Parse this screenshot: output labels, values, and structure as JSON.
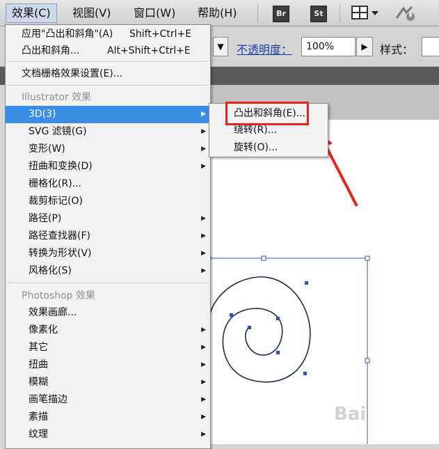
{
  "menubar": {
    "items": [
      {
        "label": "效果(C)",
        "active": true
      },
      {
        "label": "视图(V)"
      },
      {
        "label": "窗口(W)"
      },
      {
        "label": "帮助(H)"
      }
    ],
    "apps": [
      "Br",
      "St"
    ]
  },
  "controlbar": {
    "opacity_label": "不透明度：",
    "opacity_value": "100%",
    "style_label": "样式："
  },
  "menu": {
    "apply_last": {
      "label": "应用\"凸出和斜角\"(A)",
      "shortcut": "Shift+Ctrl+E"
    },
    "last_effect": {
      "label": "凸出和斜角...",
      "shortcut": "Alt+Shift+Ctrl+E"
    },
    "doc_raster": "文档栅格效果设置(E)...",
    "illustrator_header": "Illustrator 效果",
    "illustrator_items": [
      "3D(3)",
      "SVG 滤镜(G)",
      "变形(W)",
      "扭曲和变换(D)",
      "栅格化(R)...",
      "裁剪标记(O)",
      "路径(P)",
      "路径查找器(F)",
      "转换为形状(V)",
      "风格化(S)"
    ],
    "photoshop_header": "Photoshop 效果",
    "photoshop_items": [
      "效果画廊...",
      "像素化",
      "其它",
      "扭曲",
      "模糊",
      "画笔描边",
      "素描",
      "纹理"
    ]
  },
  "submenu": {
    "items": [
      "凸出和斜角(E)...",
      "绕转(R)...",
      "旋转(O)..."
    ]
  },
  "colors": {
    "highlight": "#3a8ee6",
    "annotation_red": "#e8231b",
    "path_blue": "#2a4fc4"
  },
  "watermark": "Bai"
}
